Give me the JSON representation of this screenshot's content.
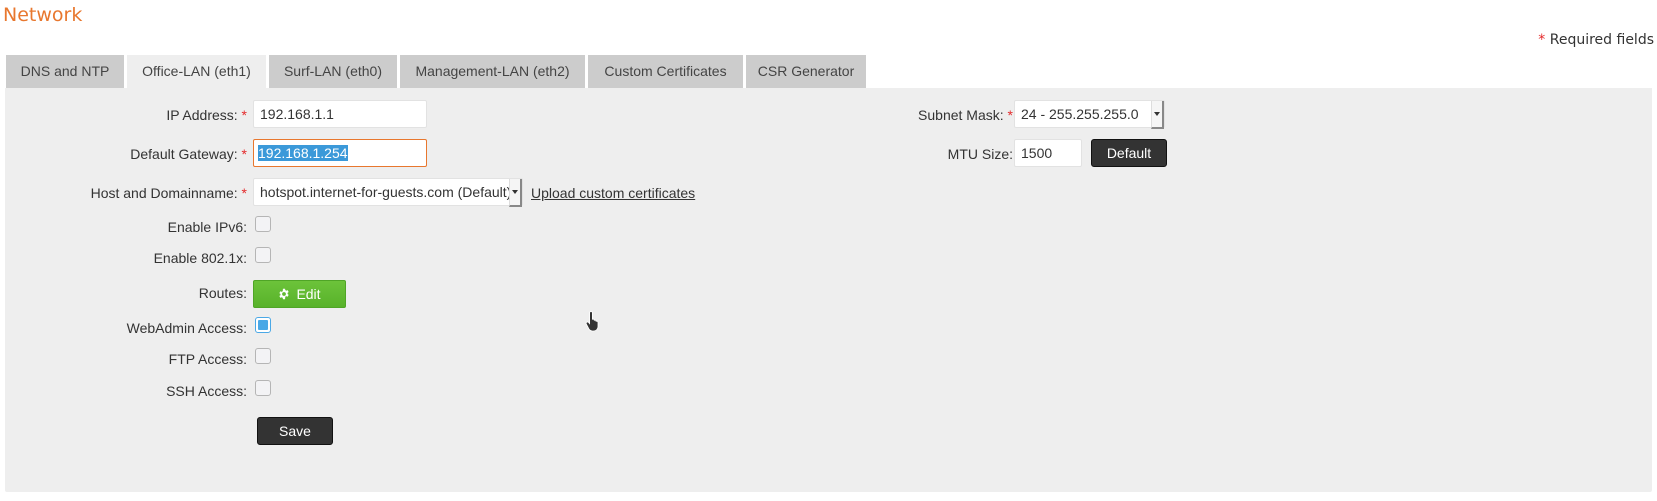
{
  "page": {
    "title": "Network",
    "required_marker": "*",
    "required_note": "Required fields"
  },
  "tabs": [
    {
      "label": "DNS and NTP",
      "active": false
    },
    {
      "label": "Office-LAN (eth1)",
      "active": true
    },
    {
      "label": "Surf-LAN (eth0)",
      "active": false
    },
    {
      "label": "Management-LAN (eth2)",
      "active": false
    },
    {
      "label": "Custom Certificates",
      "active": false
    },
    {
      "label": "CSR Generator",
      "active": false
    }
  ],
  "form": {
    "ip_address": {
      "label": "IP Address:",
      "required": true,
      "value": "192.168.1.1"
    },
    "default_gateway": {
      "label": "Default Gateway:",
      "required": true,
      "value": "192.168.1.254",
      "focused": true,
      "selected": true
    },
    "host_domainname": {
      "label": "Host and Domainname:",
      "required": true,
      "value": "hotspot.internet-for-guests.com (Default)"
    },
    "upload_link": "Upload custom certificates",
    "enable_ipv6": {
      "label": "Enable IPv6:",
      "checked": false
    },
    "enable_8021x": {
      "label": "Enable 802.1x:",
      "checked": false
    },
    "routes": {
      "label": "Routes:",
      "button": "Edit",
      "icon": "gear-icon"
    },
    "webadmin_access": {
      "label": "WebAdmin Access:",
      "checked": true
    },
    "ftp_access": {
      "label": "FTP Access:",
      "checked": false
    },
    "ssh_access": {
      "label": "SSH Access:",
      "checked": false
    },
    "subnet_mask": {
      "label": "Subnet Mask:",
      "required": true,
      "value": "24 - 255.255.255.0"
    },
    "mtu_size": {
      "label": "MTU Size:",
      "value": "1500",
      "default_button": "Default"
    },
    "save_button": "Save"
  },
  "colors": {
    "title": "#e8772e",
    "required": "#e4292a",
    "panel_bg": "#eeeeee",
    "tab_inactive": "#cccccc",
    "green_button": "#5bb52d",
    "dark_button": "#333333",
    "selection": "#3b99d9",
    "checkbox_checked": "#4aa8e6"
  }
}
